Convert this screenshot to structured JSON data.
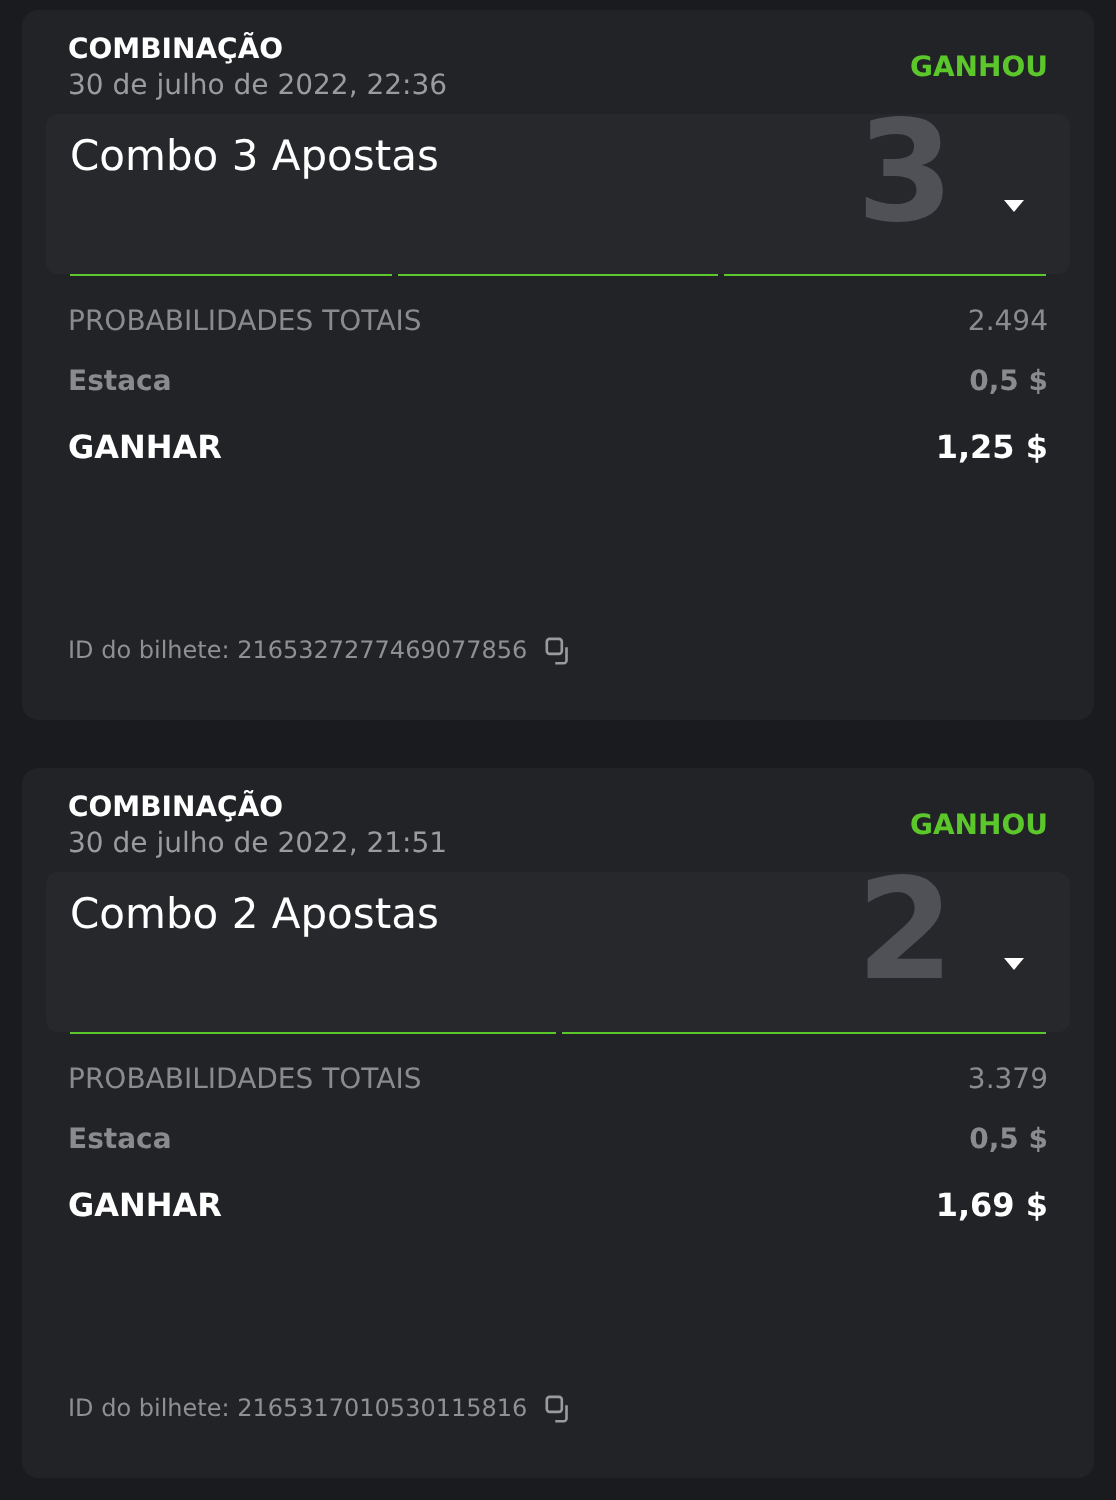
{
  "bets": [
    {
      "type": "COMBINAÇÃO",
      "date": "30 de julho de 2022, 22:36",
      "status": "GANHOU",
      "won": true,
      "combo_title": "Combo 3 Apostas",
      "combo_count": "3",
      "expanded": false,
      "legs": [
        {
          "won": true
        },
        {
          "won": true
        },
        {
          "won": true
        }
      ],
      "odds_label": "PROBABILIDADES TOTAIS",
      "odds": "2.494",
      "stake_label": "Estaca",
      "stake": "0,5 $",
      "win_label": "GANHAR",
      "win": "1,25 $",
      "ticket": "ID do bilhete: 2165327277469077856"
    },
    {
      "type": "COMBINAÇÃO",
      "date": "30 de julho de 2022, 21:51",
      "status": "GANHOU",
      "won": true,
      "combo_title": "Combo 2 Apostas",
      "combo_count": "2",
      "expanded": false,
      "legs": [
        {
          "won": true
        },
        {
          "won": true
        }
      ],
      "odds_label": "PROBABILIDADES TOTAIS",
      "odds": "3.379",
      "stake_label": "Estaca",
      "stake": "0,5 $",
      "win_label": "GANHAR",
      "win": "1,69 $",
      "ticket": "ID do bilhete: 2165317010530115816"
    }
  ]
}
